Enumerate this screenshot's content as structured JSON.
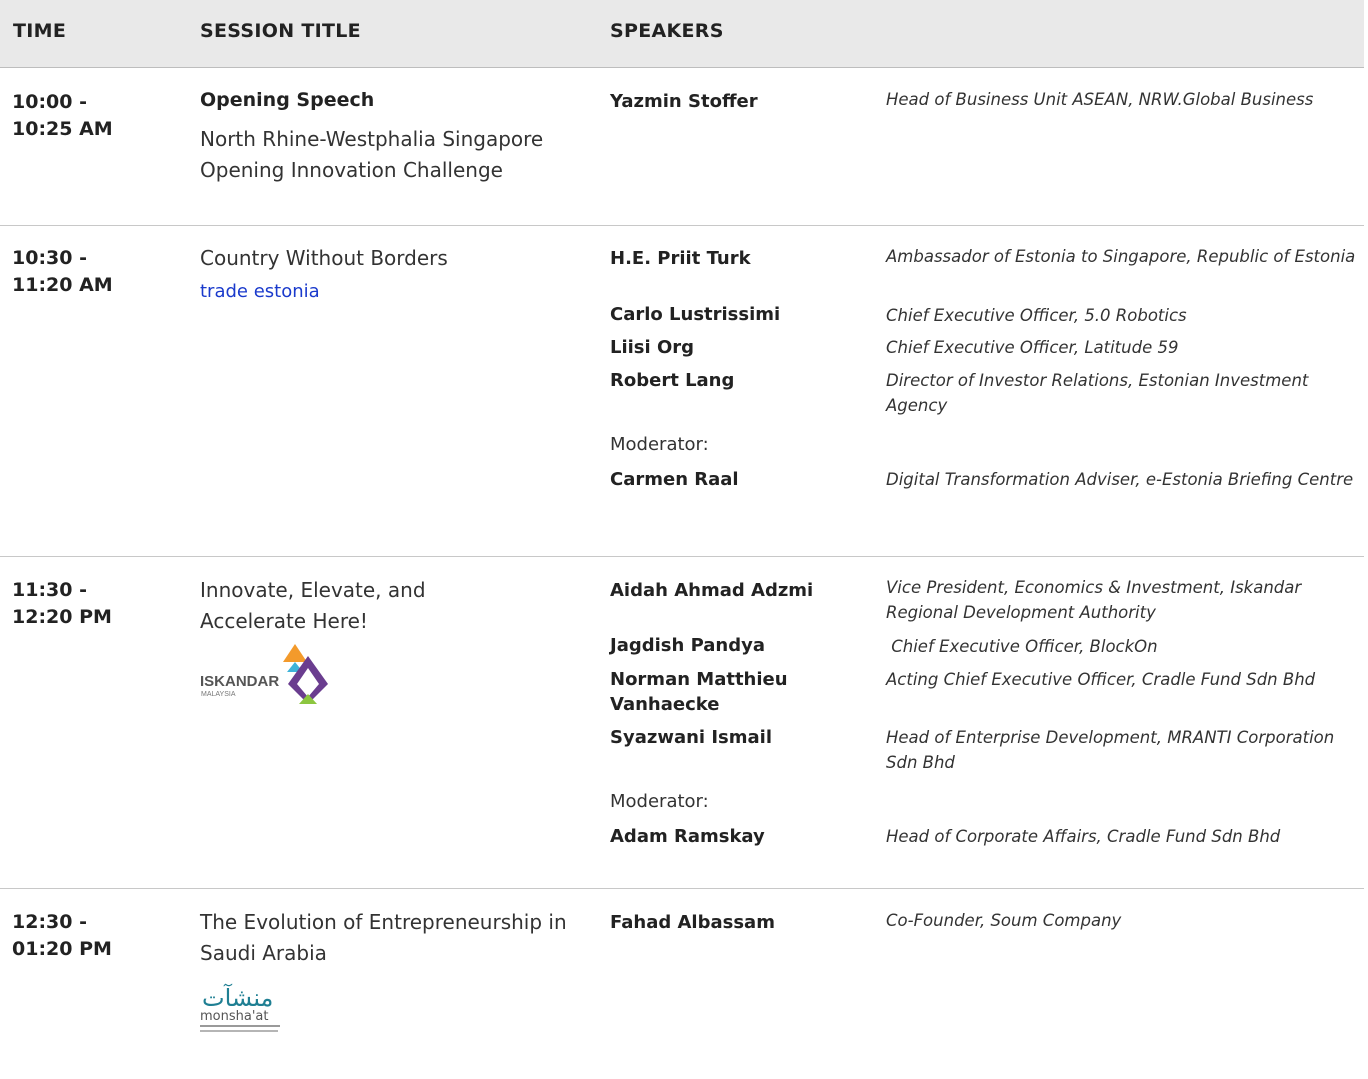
{
  "header": {
    "time": "TIME",
    "session": "SESSION TITLE",
    "speakers": "SPEAKERS"
  },
  "rows": [
    {
      "time": "10:00 -\n10:25 AM",
      "title_bold": "Opening Speech",
      "title": "North Rhine-Westphalia Singapore Opening Innovation Challenge",
      "speakers": [
        {
          "name": "Yazmin Stoffer",
          "role": "Head of Business Unit ASEAN, NRW.Global Business"
        }
      ]
    },
    {
      "time": "10:30 -\n11:20 AM",
      "title": "Country Without Borders",
      "link": "trade estonia",
      "speakers": [
        {
          "name": "H.E. Priit Turk",
          "role": "Ambassador of Estonia to Singapore, Republic of Estonia"
        },
        {
          "name": "Carlo Lustrissimi",
          "role": "Chief Executive Officer, 5.0 Robotics"
        },
        {
          "name": "Liisi Org",
          "role": "Chief Executive Officer, Latitude 59"
        },
        {
          "name": "Robert Lang",
          "role": "Director of Investor Relations, Estonian Investment Agency"
        }
      ],
      "moderator_label": "Moderator:",
      "moderator": {
        "name": "Carmen Raal",
        "role": "Digital Transformation Adviser, e-Estonia Briefing Centre"
      }
    },
    {
      "time": "11:30 -\n12:20 PM",
      "title": "Innovate, Elevate, and Accelerate Here!",
      "logo": {
        "name": "ISKANDAR",
        "sub": "MALAYSIA"
      },
      "speakers": [
        {
          "name": "Aidah Ahmad Adzmi",
          "role": "Vice President, Economics & Investment, Iskandar Regional Development Authority"
        },
        {
          "name": "Jagdish Pandya",
          "role": " Chief Executive Officer, BlockOn"
        },
        {
          "name": "Norman Matthieu Vanhaecke",
          "role": "Acting Chief Executive Officer, Cradle Fund Sdn Bhd"
        },
        {
          "name": "Syazwani Ismail",
          "role": "Head of Enterprise Development, MRANTI Corporation Sdn Bhd"
        }
      ],
      "moderator_label": "Moderator:",
      "moderator": {
        "name": "Adam Ramskay",
        "role": "Head of Corporate Affairs, Cradle Fund Sdn Bhd"
      }
    },
    {
      "time": "12:30 -\n01:20 PM",
      "title": "The Evolution of Entrepreneurship in Saudi Arabia",
      "logo": {
        "arabic": "منشآت",
        "latin": "monsha'at"
      },
      "speakers": [
        {
          "name": "Fahad Albassam",
          "role": "Co-Founder, Soum Company"
        }
      ]
    }
  ],
  "colors": {
    "header_bg": "#e9e9e9",
    "link": "#1a3acc",
    "monshaat": "#1f7f93"
  }
}
